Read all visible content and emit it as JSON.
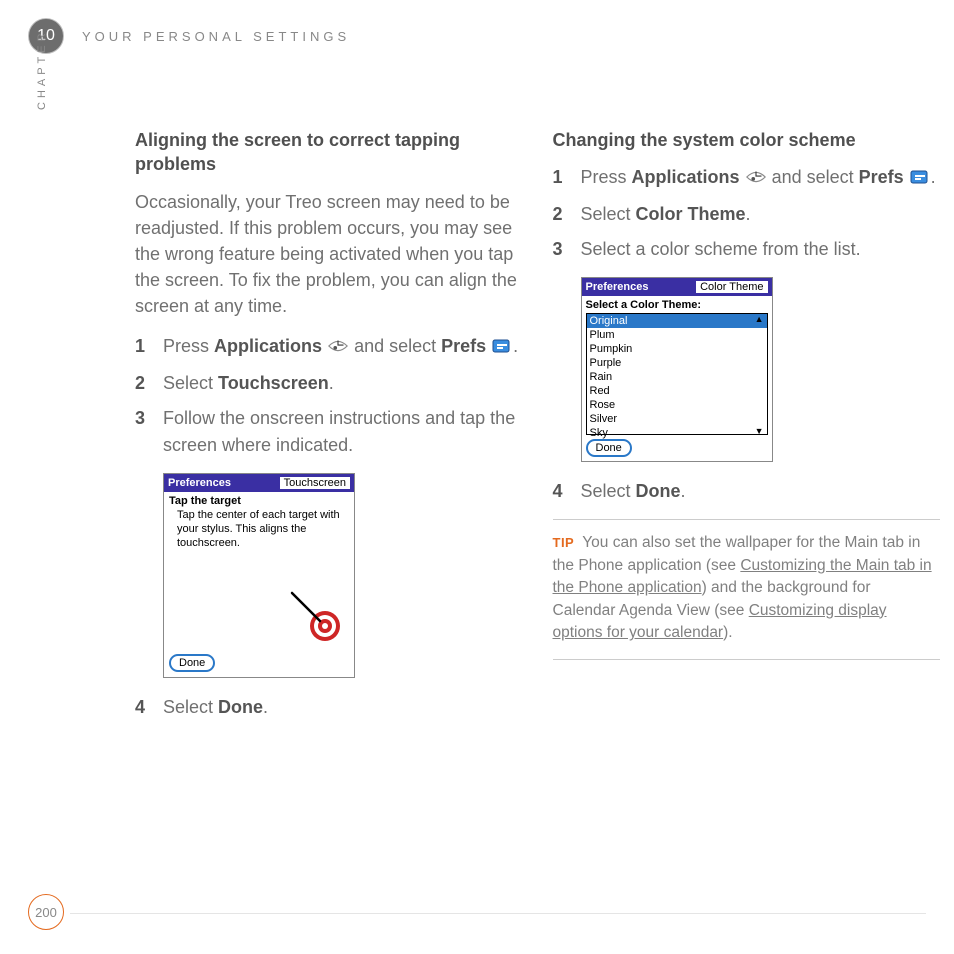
{
  "chapter": "10",
  "chapter_label": "CHAPTER",
  "page_title": "YOUR PERSONAL SETTINGS",
  "page_number": "200",
  "left": {
    "heading": "Aligning the screen to correct tapping problems",
    "intro": "Occasionally, your Treo screen may need to be readjusted. If this problem occurs, you may see the wrong feature being activated when you tap the screen. To fix the problem, you can align the screen at any time.",
    "steps": {
      "s1_a": "Press ",
      "s1_b": "Applications",
      "s1_c": " and select ",
      "s1_d": "Prefs",
      "s1_e": ".",
      "s2_a": "Select ",
      "s2_b": "Touchscreen",
      "s2_c": ".",
      "s3": "Follow the onscreen instructions and tap the screen where indicated.",
      "s4_a": "Select ",
      "s4_b": "Done",
      "s4_c": "."
    },
    "shot": {
      "title_left": "Preferences",
      "title_right": "Touchscreen",
      "heading": "Tap the target",
      "body": "Tap the center of each target with your stylus. This aligns the touchscreen.",
      "done": "Done"
    }
  },
  "right": {
    "heading": "Changing the system color scheme",
    "steps": {
      "s1_a": "Press ",
      "s1_b": "Applications",
      "s1_c": " and select ",
      "s1_d": "Prefs",
      "s1_e": ".",
      "s2_a": "Select ",
      "s2_b": "Color Theme",
      "s2_c": ".",
      "s3": "Select a color scheme from the list.",
      "s4_a": "Select ",
      "s4_b": "Done",
      "s4_c": "."
    },
    "shot": {
      "title_left": "Preferences",
      "title_right": "Color Theme",
      "heading": "Select a Color Theme:",
      "items": [
        "Original",
        "Plum",
        "Pumpkin",
        "Purple",
        "Rain",
        "Red",
        "Rose",
        "Silver",
        "Sky"
      ],
      "done": "Done"
    },
    "tip": {
      "label": "TIP",
      "t1": " You can also set the wallpaper for the Main tab in the Phone application (see ",
      "link1": "Customizing the Main tab in the Phone application",
      "t2": ") and the background for Calendar Agenda View (see ",
      "link2": "Customizing display options for your calendar",
      "t3": ")."
    }
  }
}
